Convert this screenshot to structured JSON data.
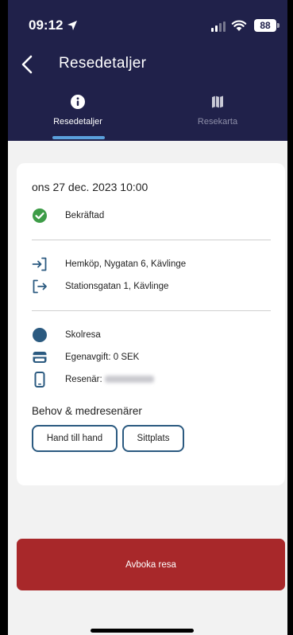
{
  "status_bar": {
    "time": "09:12",
    "battery": "88"
  },
  "header": {
    "title": "Resedetaljer"
  },
  "tabs": [
    {
      "label": "Resedetaljer",
      "icon": "info-icon",
      "active": true
    },
    {
      "label": "Resekarta",
      "icon": "map-icon",
      "active": false
    }
  ],
  "trip": {
    "date": "ons 27 dec. 2023 10:00",
    "status": "Bekräftad",
    "from": "Hemköp, Nygatan 6, Kävlinge",
    "to": "Stationsgatan 1, Kävlinge",
    "trip_type": "Skolresa",
    "fee": "Egenavgift: 0 SEK",
    "traveler_label": "Resenär:"
  },
  "needs": {
    "title": "Behov & medresenärer",
    "items": [
      "Hand till hand",
      "Sittplats"
    ]
  },
  "actions": {
    "cancel_label": "Avboka resa"
  },
  "colors": {
    "header_bg": "#20214a",
    "confirmed_green": "#3d9c47",
    "accent_blue": "#2b5a80",
    "tab_indicator": "#5aa0dc",
    "cancel_red": "#a8282a"
  }
}
